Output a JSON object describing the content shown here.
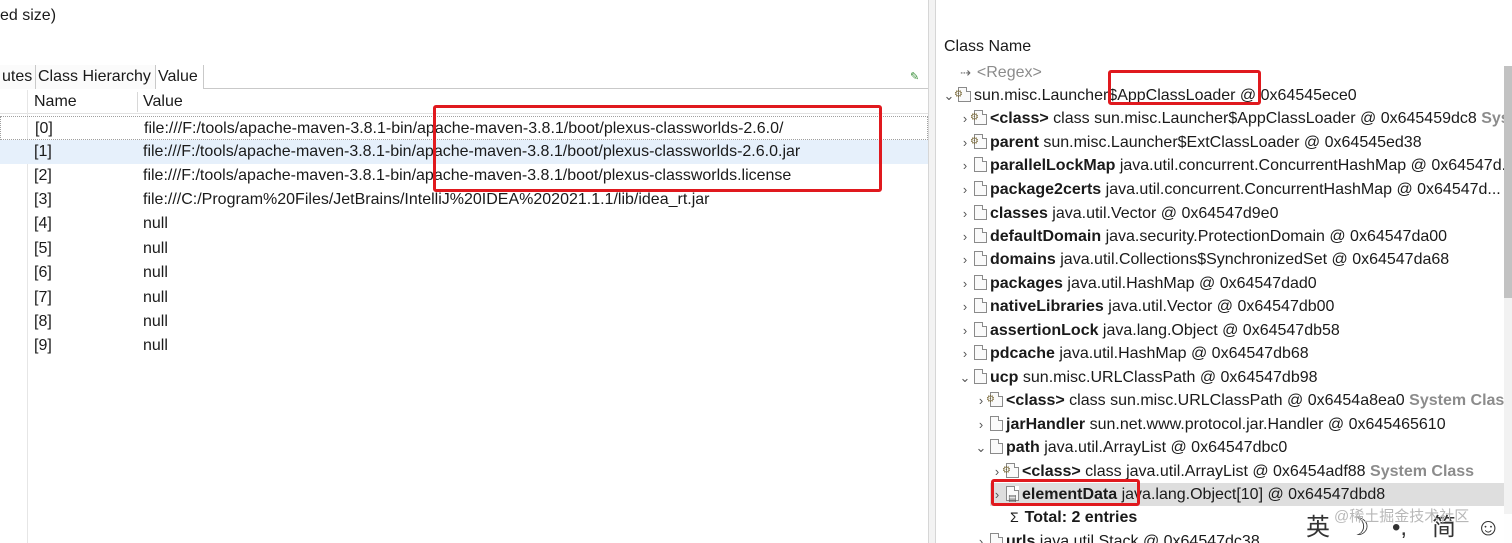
{
  "left": {
    "partial_title": "ed size)",
    "tabs": [
      "utes",
      "Class Hierarchy",
      "Value"
    ],
    "pin_glyph": "✎",
    "headers": {
      "name": "Name",
      "value": "Value"
    },
    "rows": [
      {
        "name": "[0]",
        "value": "file:///F:/tools/apache-maven-3.8.1-bin/apache-maven-3.8.1/boot/plexus-classworlds-2.6.0/"
      },
      {
        "name": "[1]",
        "value": "file:///F:/tools/apache-maven-3.8.1-bin/apache-maven-3.8.1/boot/plexus-classworlds-2.6.0.jar"
      },
      {
        "name": "[2]",
        "value": "file:///F:/tools/apache-maven-3.8.1-bin/apache-maven-3.8.1/boot/plexus-classworlds.license"
      },
      {
        "name": "[3]",
        "value": "file:///C:/Program%20Files/JetBrains/IntelliJ%20IDEA%202021.1.1/lib/idea_rt.jar"
      },
      {
        "name": "[4]",
        "value": "null"
      },
      {
        "name": "[5]",
        "value": "null"
      },
      {
        "name": "[6]",
        "value": "null"
      },
      {
        "name": "[7]",
        "value": "null"
      },
      {
        "name": "[8]",
        "value": "null"
      },
      {
        "name": "[9]",
        "value": "null"
      }
    ]
  },
  "right": {
    "header": "Class Name",
    "regex": {
      "glyph": "⇢",
      "text": "<Regex>"
    },
    "root": {
      "text": "sun.misc.Launcher$AppClassLoader @ 0x64545ece0",
      "chevron": "⌄"
    },
    "nodes": [
      {
        "chev": "›",
        "field": "<class>",
        "rest": " class sun.misc.Launcher$AppClassLoader @ 0x645459dc8 ",
        "sys": "System Class"
      },
      {
        "chev": "›",
        "field": "parent",
        "rest": " sun.misc.Launcher$ExtClassLoader @ 0x64545ed38",
        "sys": ""
      },
      {
        "chev": "›",
        "field": "parallelLockMap",
        "rest": " java.util.concurrent.ConcurrentHashMap @ 0x64547d...",
        "sys": ""
      },
      {
        "chev": "›",
        "field": "package2certs",
        "rest": " java.util.concurrent.ConcurrentHashMap @ 0x64547d...",
        "sys": ""
      },
      {
        "chev": "›",
        "field": "classes",
        "rest": " java.util.Vector @ 0x64547d9e0",
        "sys": ""
      },
      {
        "chev": "›",
        "field": "defaultDomain",
        "rest": " java.security.ProtectionDomain @ 0x64547da00",
        "sys": ""
      },
      {
        "chev": "›",
        "field": "domains",
        "rest": " java.util.Collections$SynchronizedSet @ 0x64547da68",
        "sys": ""
      },
      {
        "chev": "›",
        "field": "packages",
        "rest": " java.util.HashMap @ 0x64547dad0",
        "sys": ""
      },
      {
        "chev": "›",
        "field": "nativeLibraries",
        "rest": " java.util.Vector @ 0x64547db00",
        "sys": ""
      },
      {
        "chev": "›",
        "field": "assertionLock",
        "rest": " java.lang.Object @ 0x64547db58",
        "sys": ""
      },
      {
        "chev": "›",
        "field": "pdcache",
        "rest": " java.util.HashMap @ 0x64547db68",
        "sys": ""
      },
      {
        "chev": "⌄",
        "field": "ucp",
        "rest": " sun.misc.URLClassPath @ 0x64547db98",
        "sys": ""
      },
      {
        "chev": "›",
        "field": "<class>",
        "rest": " class sun.misc.URLClassPath @ 0x6454a8ea0 ",
        "sys": "System Class"
      },
      {
        "chev": "›",
        "field": "jarHandler",
        "rest": " sun.net.www.protocol.jar.Handler @ 0x645465610",
        "sys": ""
      },
      {
        "chev": "⌄",
        "field": "path",
        "rest": " java.util.ArrayList @ 0x64547dbc0",
        "sys": ""
      },
      {
        "chev": "›",
        "field": "<class>",
        "rest": " class java.util.ArrayList @ 0x6454adf88 ",
        "sys": "System Class"
      },
      {
        "chev": "›",
        "field": "elementData",
        "rest": " java.lang.Object[10] @ 0x64547dbd8",
        "sys": ""
      },
      {
        "chev": "",
        "field": "Total: 2 entries",
        "rest": "",
        "sys": ""
      },
      {
        "chev": "›",
        "field": "urls",
        "rest": " java.util.Stack @ 0x64547dc38",
        "sys": ""
      }
    ]
  },
  "ime": {
    "lang": "英",
    "moon": "☽",
    "punct": "•,",
    "simp": "简",
    "emoji": "☺"
  },
  "watermark": "@稀土掘金技术社区",
  "colors": {
    "highlight_red": "#e0191e",
    "selection_blue": "#e6f0fb",
    "system_class_gray": "#8c8c8c"
  }
}
